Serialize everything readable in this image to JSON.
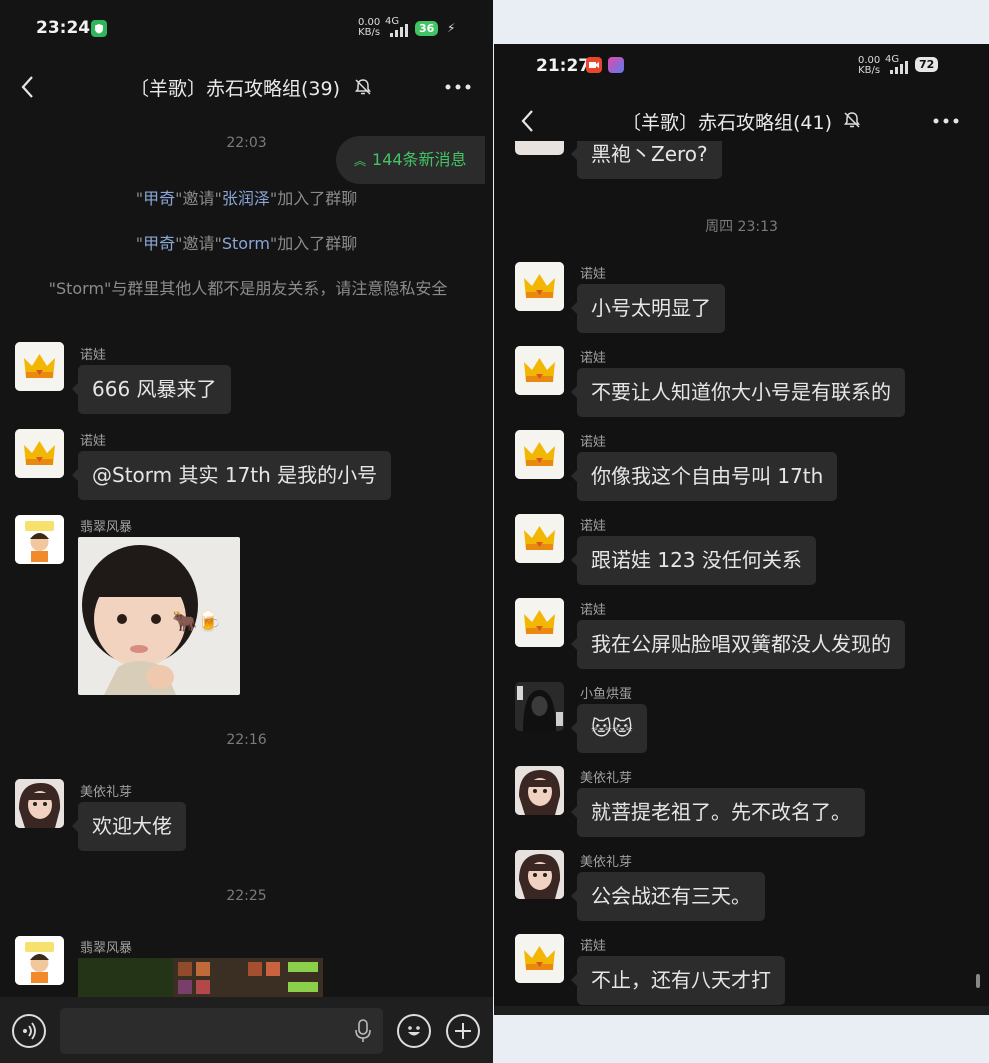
{
  "left": {
    "status": {
      "time": "23:24",
      "net_speed": "0.00\nKB/s",
      "net": "4G",
      "battery": "36"
    },
    "header": {
      "title": "〔羊歌〕赤石攻略组(39)"
    },
    "new_messages_label": "144条新消息",
    "timestamps": [
      "22:03",
      "22:16",
      "22:25"
    ],
    "system_messages": [
      {
        "q1": "\"",
        "name1": "甲奇",
        "mid": "\"邀请\"",
        "name2": "张润泽",
        "end": "\"加入了群聊"
      },
      {
        "q1": "\"",
        "name1": "甲奇",
        "mid": "\"邀请\"",
        "name2": "Storm",
        "end": "\"加入了群聊"
      },
      {
        "text": "\"Storm\"与群里其他人都不是朋友关系，请注意隐私安全"
      }
    ],
    "messages": [
      {
        "sender": "诺娃",
        "text": "666 风暴来了"
      },
      {
        "sender": "诺娃",
        "text": "@Storm  其实 17th 是我的小号"
      },
      {
        "sender": "翡翠风暴",
        "text": ""
      },
      {
        "sender": "美依礼芽",
        "text": "欢迎大佬"
      },
      {
        "sender": "翡翠风暴",
        "text": ""
      }
    ],
    "sticker_emoji": "🐂🍺"
  },
  "right": {
    "status": {
      "time": "21:27",
      "net_speed": "0.00\nKB/s",
      "net": "4G",
      "battery": "72"
    },
    "header": {
      "title": "〔羊歌〕赤石攻略组(41)"
    },
    "top_partial_text": "黑袍丶Zero?",
    "timestamp": "周四 23:13",
    "messages": [
      {
        "sender": "诺娃",
        "text": "小号太明显了"
      },
      {
        "sender": "诺娃",
        "text": "不要让人知道你大小号是有联系的"
      },
      {
        "sender": "诺娃",
        "text": "你像我这个自由号叫 17th"
      },
      {
        "sender": "诺娃",
        "text": "跟诺娃 123 没任何关系"
      },
      {
        "sender": "诺娃",
        "text": "我在公屏贴脸唱双簧都没人发现的"
      },
      {
        "sender": "小鱼烘蛋",
        "text": "🐱🐱"
      },
      {
        "sender": "美依礼芽",
        "text": "就菩提老祖了。先不改名了。"
      },
      {
        "sender": "美依礼芽",
        "text": "公会战还有三天。"
      },
      {
        "sender": "诺娃",
        "text": "不止，还有八天才打"
      }
    ]
  },
  "colors": {
    "accent_green": "#43c464",
    "bubble": "#2c2c2c",
    "background": "#141414"
  }
}
